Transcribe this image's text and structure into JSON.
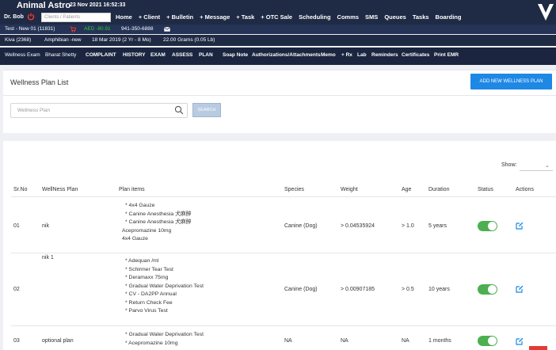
{
  "topbar": {
    "app_name": "Animal Astro",
    "datetime": "23 Nov 2021 16:52:33",
    "user": "Dr. Bob",
    "search_placeholder": "Clients / Patients",
    "nav": [
      "Home",
      "+ Client",
      "+ Bulletin",
      "+ Message",
      "+ Task",
      "+ OTC Sale",
      "Scheduling",
      "Comms",
      "SMS",
      "Queues",
      "Tasks",
      "Boarding"
    ]
  },
  "client_bar": {
    "client": "Test - New 01 (11831)",
    "balance": "AED -80.91",
    "phone": "941-350-6888"
  },
  "patient_bar": {
    "patient": "Kiva (2368)",
    "species": "Amphibian -new",
    "dob": "18 Mar 2019 (2 Yr - 8 Mo)",
    "weight": "22.00 Grams (0.05 Lb)"
  },
  "tabs_bar": {
    "visit": "Wellness Exam",
    "doctor": "Bharat Shetty",
    "tabs": [
      "COMPLAINT",
      "HISTORY",
      "EXAM",
      "ASSESS",
      "PLAN",
      "Soap Note",
      "Authorizations/Attachments",
      "Memo",
      "+ Rx",
      "Lab",
      "Reminders",
      "Certificates",
      "Print EMR"
    ]
  },
  "plan_panel": {
    "title": "Wellness Plan List",
    "add_button": "ADD NEW WELLNESS PLAN",
    "input_placeholder": "Wellness Plan",
    "search_button": "SEARCH"
  },
  "table": {
    "show_label": "Show:",
    "headers": [
      "Sr.No",
      "WellNess Plan",
      "Plan items",
      "Species",
      "Weight",
      "Age",
      "Duration",
      "Status",
      "Actions"
    ],
    "rows": [
      {
        "sr": "01",
        "plan": "nik",
        "items": [
          "* 4x4 Gauze",
          "* Canine Anesthesia 犬麻醉",
          "* Canine Anesthesia 犬麻醉",
          "Acepromazine 10mg",
          "4x4 Gauze"
        ],
        "species": "Canine (Dog)",
        "weight": "> 0.04535924",
        "age": "> 1.0",
        "duration": "5 years",
        "status": true
      },
      {
        "sr": "02",
        "plan": "nik 1",
        "items": [
          "* Adequan /ml",
          "* Schirmer Tear Test",
          "* Deramaxx 75mg",
          "* Gradual Water Deprivation Test",
          "* CV - DA2PP Annual",
          "* Return Check Fee",
          "* Parvo Virus Test"
        ],
        "species": "Canine (Dog)",
        "weight": "> 0.00907185",
        "age": "> 0.5",
        "duration": "10 years",
        "status": true
      },
      {
        "sr": "03",
        "plan": "optional plan",
        "items": [
          "* Gradual Water Deprivation Test",
          "* Acepromazine 10mg"
        ],
        "species": "NA",
        "weight": "NA",
        "age": "NA",
        "duration": "1 months",
        "status": true
      }
    ]
  },
  "colors": {
    "navbar": "#1f2a44",
    "accent": "#1e88e5",
    "toggle_on": "#4caf50",
    "balance": "#33cc33",
    "cart": "#e53935"
  }
}
